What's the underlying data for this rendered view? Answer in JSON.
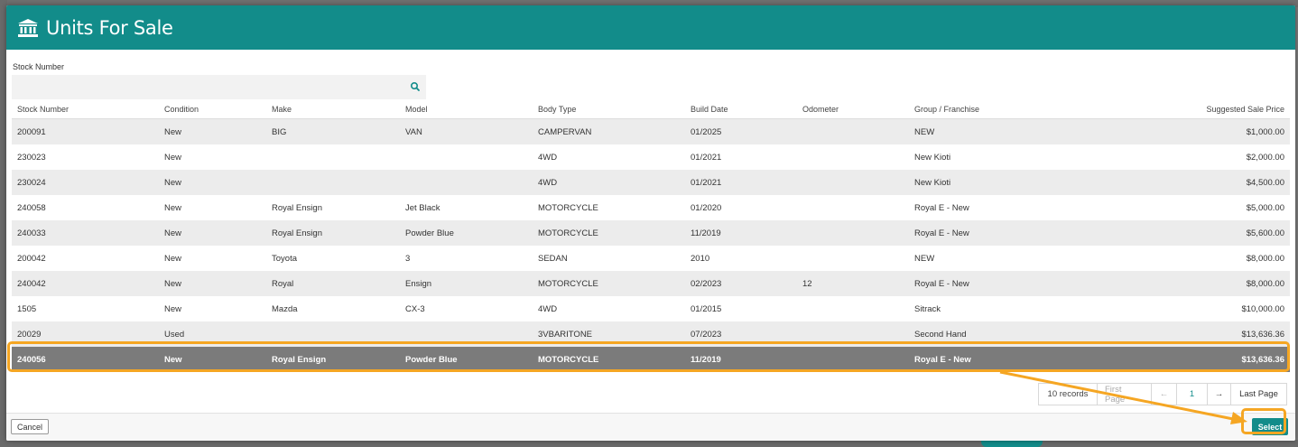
{
  "modal": {
    "title": "Units For Salе",
    "header_icon": "bank-icon",
    "accent_color": "#128c8a",
    "highlight_color": "#f5a623"
  },
  "search": {
    "label": "Stock Number",
    "value": "",
    "placeholder": "",
    "icon": "search-icon"
  },
  "table": {
    "columns": [
      "Stock Number",
      "Condition",
      "Make",
      "Model",
      "Body Type",
      "Build Date",
      "Odometer",
      "Group / Franchise",
      "Suggested Sale Price"
    ],
    "rows": [
      {
        "stock": "200091",
        "condition": "New",
        "make": "BIG",
        "model": "VAN",
        "body": "CAMPERVAN",
        "build": "01/2025",
        "odometer": "",
        "group": "NEW",
        "price": "$1,000.00"
      },
      {
        "stock": "230023",
        "condition": "New",
        "make": "",
        "model": "",
        "body": "4WD",
        "build": "01/2021",
        "odometer": "",
        "group": "New Kioti",
        "price": "$2,000.00"
      },
      {
        "stock": "230024",
        "condition": "New",
        "make": "",
        "model": "",
        "body": "4WD",
        "build": "01/2021",
        "odometer": "",
        "group": "New Kioti",
        "price": "$4,500.00"
      },
      {
        "stock": "240058",
        "condition": "New",
        "make": "Royal Ensign",
        "model": "Jet Black",
        "body": "MOTORCYCLE",
        "build": "01/2020",
        "odometer": "",
        "group": "Royal E - New",
        "price": "$5,000.00"
      },
      {
        "stock": "240033",
        "condition": "New",
        "make": "Royal Ensign",
        "model": "Powder Blue",
        "body": "MOTORCYCLE",
        "build": "11/2019",
        "odometer": "",
        "group": "Royal E - New",
        "price": "$5,600.00"
      },
      {
        "stock": "200042",
        "condition": "New",
        "make": "Toyota",
        "model": "3",
        "body": "SEDAN",
        "build": "2010",
        "odometer": "",
        "group": "NEW",
        "price": "$8,000.00"
      },
      {
        "stock": "240042",
        "condition": "New",
        "make": "Royal",
        "model": "Ensign",
        "body": "MOTORCYCLE",
        "build": "02/2023",
        "odometer": "12",
        "group": "Royal E - New",
        "price": "$8,000.00"
      },
      {
        "stock": "1505",
        "condition": "New",
        "make": "Mazda",
        "model": "CX-3",
        "body": "4WD",
        "build": "01/2015",
        "odometer": "",
        "group": "Sitrack",
        "price": "$10,000.00"
      },
      {
        "stock": "20029",
        "condition": "Used",
        "make": "",
        "model": "",
        "body": "3VBARITONE",
        "build": "07/2023",
        "odometer": "",
        "group": "Second Hand",
        "price": "$13,636.36"
      },
      {
        "stock": "240056",
        "condition": "New",
        "make": "Royal Ensign",
        "model": "Powder Blue",
        "body": "MOTORCYCLE",
        "build": "11/2019",
        "odometer": "",
        "group": "Royal E - New",
        "price": "$13,636.36",
        "selected": true
      }
    ]
  },
  "pager": {
    "records": "10 records",
    "first": "First Page",
    "prev": "←",
    "page": "1",
    "next": "→",
    "last": "Last Page"
  },
  "footer": {
    "cancel": "Cancel",
    "select": "Select"
  }
}
